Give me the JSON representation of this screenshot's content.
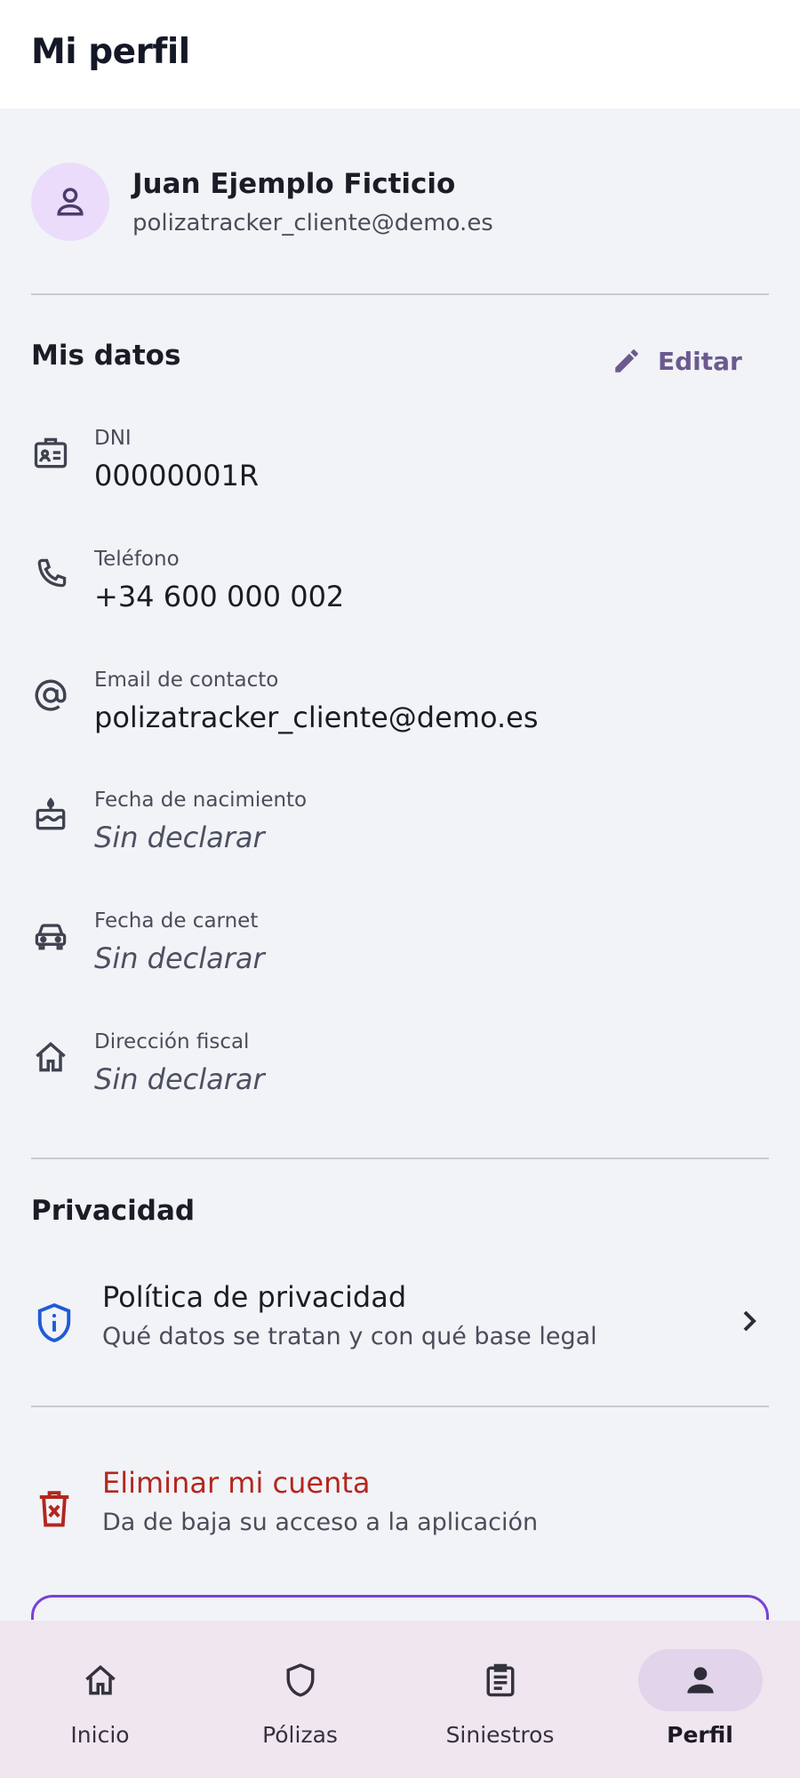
{
  "app_bar": {
    "title": "Mi perfil"
  },
  "profile": {
    "name": "Juan Ejemplo Ficticio",
    "email": "polizatracker_cliente@demo.es"
  },
  "mis_datos": {
    "title": "Mis datos",
    "edit_label": "Editar",
    "fields": [
      {
        "icon": "id-card-icon",
        "label": "DNI",
        "value": "00000001R"
      },
      {
        "icon": "phone-icon",
        "label": "Teléfono",
        "value": "+34 600 000 002"
      },
      {
        "icon": "at-sign-icon",
        "label": "Email de contacto",
        "value": "polizatracker_cliente@demo.es"
      },
      {
        "icon": "cake-icon",
        "label": "Fecha de nacimiento",
        "value": "Sin declarar"
      },
      {
        "icon": "car-icon",
        "label": "Fecha de carnet",
        "value": "Sin declarar"
      },
      {
        "icon": "home-icon",
        "label": "Dirección fiscal",
        "value": "Sin declarar"
      }
    ]
  },
  "privacidad": {
    "title": "Privacidad",
    "policy": {
      "title": "Política de privacidad",
      "subtitle": "Qué datos se tratan y con qué base legal"
    }
  },
  "delete_account": {
    "title": "Eliminar mi cuenta",
    "subtitle": "Da de baja su acceso a la aplicación"
  },
  "bottom_nav": {
    "items": [
      {
        "icon": "home-icon",
        "label": "Inicio",
        "active": false
      },
      {
        "icon": "shield-icon",
        "label": "Pólizas",
        "active": false
      },
      {
        "icon": "clipboard-icon",
        "label": "Siniestros",
        "active": false
      },
      {
        "icon": "person-icon",
        "label": "Perfil",
        "active": true
      }
    ]
  },
  "colors": {
    "background": "#f1f3f7",
    "accent": "#6b5a8e",
    "danger": "#b3261e",
    "info_blue": "#1e5bd6",
    "nav_background": "#efe6f0",
    "nav_active_pill": "#e2d4ea",
    "avatar_background": "#ebdcfb",
    "outline_button": "#7b40d9"
  }
}
